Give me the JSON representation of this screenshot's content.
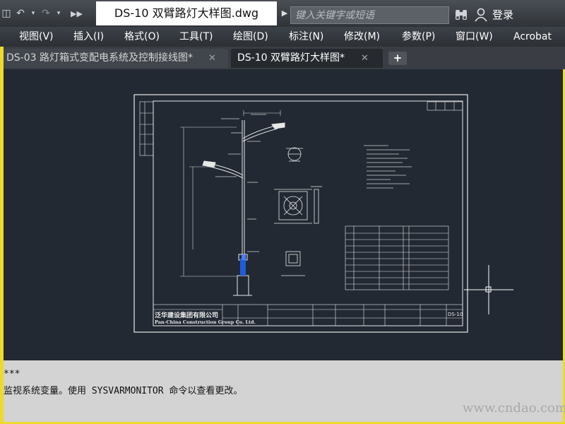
{
  "titlebar": {
    "document_title": "DS-10  双臂路灯大样图.dwg",
    "search_placeholder": "键入关键字或短语",
    "login_label": "登录",
    "icons": [
      "open-icon",
      "undo-icon",
      "dropdown-icon",
      "redo-icon",
      "dropdown-icon",
      "more-icon",
      "search-arrow-icon",
      "binoculars-icon",
      "user-icon"
    ]
  },
  "menu": {
    "items": [
      "视图(V)",
      "插入(I)",
      "格式(O)",
      "工具(T)",
      "绘图(D)",
      "标注(N)",
      "修改(M)",
      "参数(P)",
      "窗口(W)",
      "Acrobat"
    ]
  },
  "tabs": [
    {
      "label": "DS-03 路灯箱式变配电系统及控制接线图*",
      "active": false
    },
    {
      "label": "DS-10  双臂路灯大样图*",
      "active": true
    }
  ],
  "drawing": {
    "company_cn": "泛华建设集团有限公司",
    "company_en": "Pan-China Construction Group Co. Ltd.",
    "sheet_no": "DS-10"
  },
  "command": {
    "line1": "***",
    "line2": "监视系统变量。使用 SYSVARMONITOR 命令以查看更改。"
  },
  "watermark": "www.cndao.com",
  "colors": {
    "title_bg": "#363a40",
    "canvas_bg": "#222933",
    "command_bg": "#d3d3d3",
    "frame_yellow": "#ecdb2c"
  }
}
